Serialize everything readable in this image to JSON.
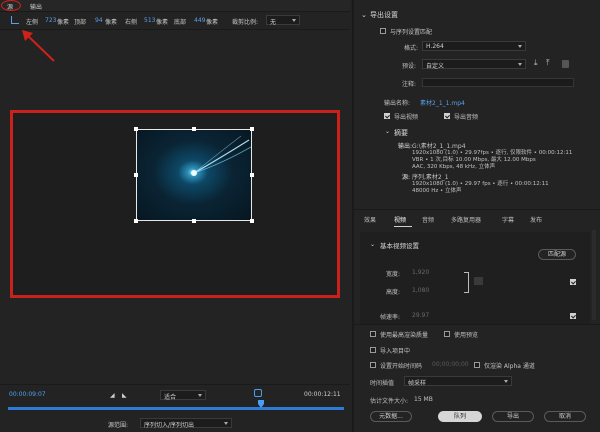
{
  "tabs": {
    "source": "源",
    "output": "输出"
  },
  "crop": {
    "left_label": "左侧",
    "left_val": "723",
    "px": "像素",
    "top_label": "顶部",
    "top_val": "94",
    "right_label": "右侧",
    "right_val": "513",
    "bottom_label": "底部",
    "bottom_val": "449",
    "ratio_label": "裁剪比例:",
    "ratio_val": "无"
  },
  "timeline": {
    "current": "00:00:09:07",
    "end": "00:00:12:11",
    "fit": "适合",
    "range_label": "源范围:",
    "range_val": "序列切入/序列切出"
  },
  "export": {
    "header": "导出设置",
    "match_seq": "与序列设置匹配",
    "format_label": "格式:",
    "format_val": "H.264",
    "preset_label": "预设:",
    "preset_val": "自定义",
    "comment_label": "注释:",
    "output_label": "输出名称:",
    "output_val": "素材2_1_1.mp4",
    "export_video": "导出视频",
    "export_audio": "导出音频",
    "summary_title": "摘要",
    "out_label": "输出:",
    "out_path": "G:\\素材2_1_1.mp4",
    "out_l1": "1920x1080 (1.0) • 29.97fps • 逐行, 仅限软件 • 00:00:12:11",
    "out_l2": "VBR • 1 次,目标 10.00 Mbps, 最大 12.00 Mbps",
    "out_l3": "AAC, 320 Kbps, 48 kHz, 立体声",
    "src_label": "源:",
    "src_name": "序列,素材2_1",
    "src_l1": "1920x1080 (1.0) • 29.97 fps • 逐行 • 00:00:12:11",
    "src_l2": "48000 Hz • 立体声"
  },
  "tabs2": [
    "效果",
    "视频",
    "音频",
    "多路复用器",
    "字幕",
    "发布"
  ],
  "video": {
    "section": "基本视频设置",
    "match_btn": "匹配源",
    "width_label": "宽度:",
    "width_val": "1,920",
    "height_label": "高度:",
    "height_val": "1,080",
    "framerate_label": "帧速率:",
    "framerate_val": "29.97"
  },
  "bottom": {
    "max_quality": "使用最高渲染质量",
    "use_preview": "使用预览",
    "import_project": "导入项目中",
    "set_start_tc": "设置开始时间码",
    "start_tc_val": "00;00;00;00",
    "alpha_only": "仅渲染 Alpha 通道",
    "interp_label": "时间插值",
    "interp_val": "帧采样",
    "filesize_label": "估计文件大小:",
    "filesize_val": "15 MB"
  },
  "buttons": {
    "metadata": "元数据...",
    "queue": "队列",
    "export": "导出",
    "cancel": "取消"
  },
  "colors": {
    "accent": "#2f7ad6",
    "annotation": "#c9211c"
  }
}
